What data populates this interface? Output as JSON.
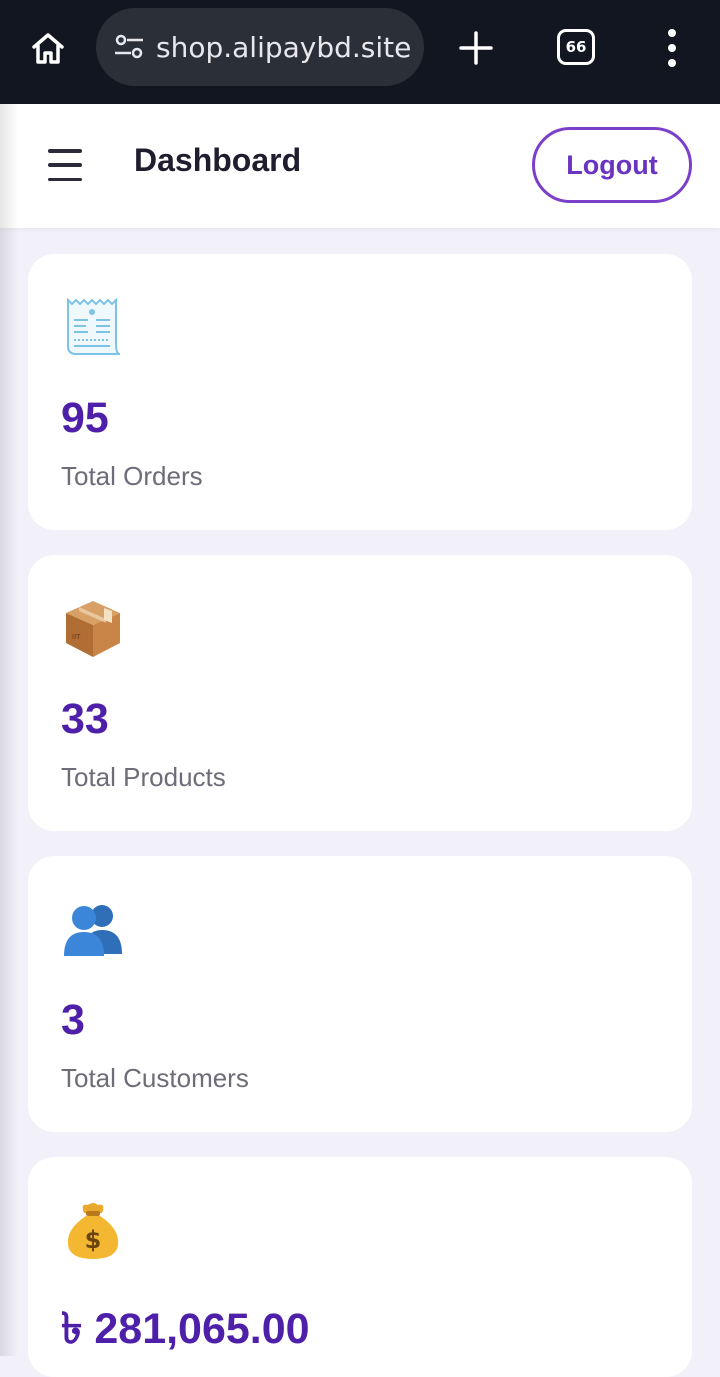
{
  "browser": {
    "url": "shop.alipaybd.site",
    "tab_count": "66"
  },
  "header": {
    "title": "Dashboard",
    "logout_label": "Logout"
  },
  "stats": [
    {
      "icon": "receipt-icon",
      "value": "95",
      "label": "Total Orders"
    },
    {
      "icon": "package-icon",
      "value": "33",
      "label": "Total Products"
    },
    {
      "icon": "users-icon",
      "value": "3",
      "label": "Total Customers"
    },
    {
      "icon": "money-bag-icon",
      "value": "৳ 281,065.00",
      "label": ""
    }
  ],
  "colors": {
    "accent": "#6a33c2",
    "value_color": "#4e1fa8",
    "background": "#f2f0f9",
    "browser_bar": "#121620"
  }
}
